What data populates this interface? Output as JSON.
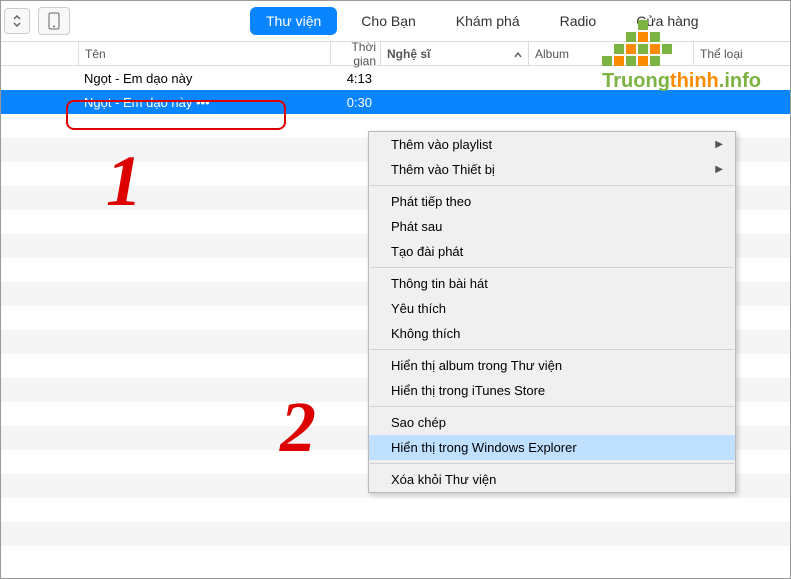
{
  "nav": {
    "tabs": [
      {
        "label": "Thư viện",
        "active": true
      },
      {
        "label": "Cho Bạn",
        "active": false
      },
      {
        "label": "Khám phá",
        "active": false
      },
      {
        "label": "Radio",
        "active": false
      },
      {
        "label": "Cửa hàng",
        "active": false
      }
    ]
  },
  "columns": {
    "name": "Tên",
    "time": "Thời gian",
    "artist": "Nghệ sĩ",
    "album": "Album",
    "genre": "Thể loại"
  },
  "rows": [
    {
      "name": "Ngọt - Em dạo này",
      "time": "4:13",
      "selected": false
    },
    {
      "name": "Ngọt - Em dạo này •••",
      "time": "0:30",
      "selected": true
    }
  ],
  "annotations": {
    "num1": "1",
    "num2": "2"
  },
  "context_menu": {
    "items": [
      {
        "label": "Thêm vào playlist",
        "submenu": true
      },
      {
        "label": "Thêm vào Thiết bị",
        "submenu": true
      },
      {
        "sep": true
      },
      {
        "label": "Phát tiếp theo"
      },
      {
        "label": "Phát sau"
      },
      {
        "label": "Tạo đài phát"
      },
      {
        "sep": true
      },
      {
        "label": "Thông tin bài hát"
      },
      {
        "label": "Yêu thích"
      },
      {
        "label": "Không thích"
      },
      {
        "sep": true
      },
      {
        "label": "Hiển thị album trong Thư viện"
      },
      {
        "label": "Hiển thị trong iTunes Store"
      },
      {
        "sep": true
      },
      {
        "label": "Sao chép"
      },
      {
        "label": "Hiển thị trong Windows Explorer",
        "highlight": true
      },
      {
        "sep": true
      },
      {
        "label": "Xóa khỏi Thư viện"
      }
    ]
  },
  "watermark": {
    "text1": "Truong",
    "text2": "thinh",
    "text3": ".info"
  }
}
